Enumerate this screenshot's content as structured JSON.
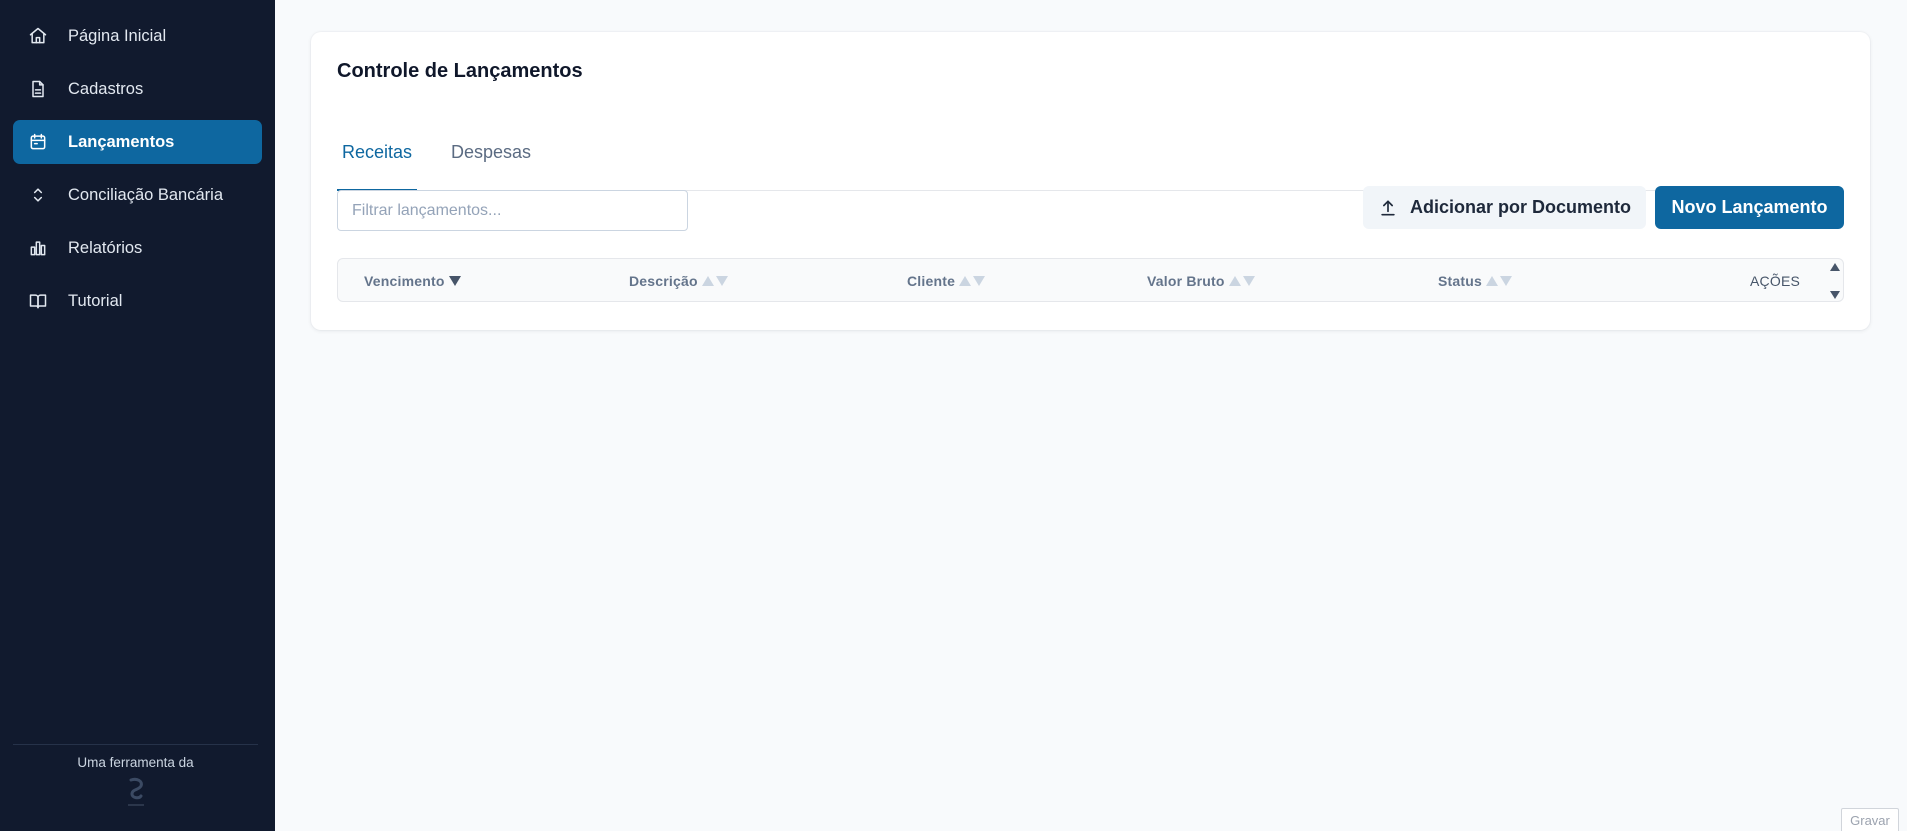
{
  "sidebar": {
    "items": [
      {
        "label": "Página Inicial",
        "icon": "home-icon"
      },
      {
        "label": "Cadastros",
        "icon": "document-icon"
      },
      {
        "label": "Lançamentos",
        "icon": "calendar-icon",
        "active": true
      },
      {
        "label": "Conciliação Bancária",
        "icon": "chevron-up-down-icon"
      },
      {
        "label": "Relatórios",
        "icon": "bar-chart-icon"
      },
      {
        "label": "Tutorial",
        "icon": "book-icon"
      }
    ],
    "footer_text": "Uma ferramenta da"
  },
  "main": {
    "title": "Controle de Lançamentos",
    "tabs": [
      {
        "label": "Receitas",
        "active": true
      },
      {
        "label": "Despesas",
        "active": false
      }
    ],
    "filter_placeholder": "Filtrar lançamentos...",
    "buttons": {
      "add_document": "Adicionar por Documento",
      "new_entry": "Novo Lançamento"
    },
    "table": {
      "columns": [
        "Vencimento",
        "Descrição",
        "Cliente",
        "Valor Bruto",
        "Status",
        "AÇÕES"
      ]
    }
  },
  "record_button": "Gravar",
  "colors": {
    "sidebar_bg": "#111a2e",
    "accent": "#0e67a0",
    "page_bg": "#f8fafc"
  }
}
